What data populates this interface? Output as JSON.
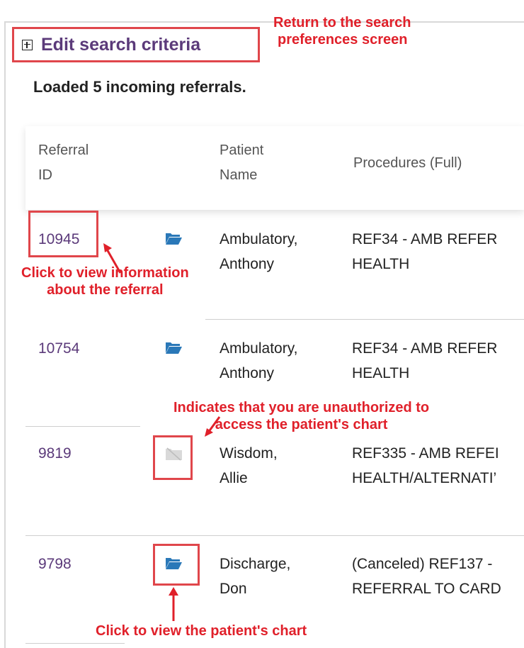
{
  "search": {
    "edit_criteria_label": "Edit search criteria",
    "loaded_message": "Loaded 5 incoming referrals."
  },
  "table": {
    "headers": {
      "referral_id": [
        "Referral",
        "ID"
      ],
      "patient_name": [
        "Patient",
        "Name"
      ],
      "procedures": "Procedures (Full)"
    },
    "rows": [
      {
        "id": "10945",
        "chart_icon": "folder-open-icon",
        "name_line1": "Ambulatory,",
        "name_line2": "Anthony",
        "proc_line1": "REF34 - AMB REFER",
        "proc_line2": "HEALTH"
      },
      {
        "id": "10754",
        "chart_icon": "folder-open-icon",
        "name_line1": "Ambulatory,",
        "name_line2": "Anthony",
        "proc_line1": "REF34 - AMB REFER",
        "proc_line2": "HEALTH"
      },
      {
        "id": "9819",
        "chart_icon": "folder-disabled-icon",
        "name_line1": "Wisdom,",
        "name_line2": "Allie",
        "proc_line1": "REF335 - AMB REFEI",
        "proc_line2": "HEALTH/ALTERNATI’"
      },
      {
        "id": "9798",
        "chart_icon": "folder-open-icon",
        "name_line1": "Discharge,",
        "name_line2": "Don",
        "proc_line1": "(Canceled) REF137 -",
        "proc_line2": "REFERRAL TO CARD"
      }
    ]
  },
  "annotations": {
    "return": [
      "Return to the search",
      "preferences screen"
    ],
    "view_referral": [
      "Click to view information",
      "about the referral"
    ],
    "unauthorized": [
      "Indicates that you are unauthorized to",
      "access the patient's chart"
    ],
    "view_chart": "Click to view the patient's chart"
  },
  "colors": {
    "link": "#5b3a7a",
    "annotation": "#e0202a",
    "highlight": "#e0464b",
    "folder": "#2a78b8",
    "folder_disabled": "#cfcfcf"
  }
}
